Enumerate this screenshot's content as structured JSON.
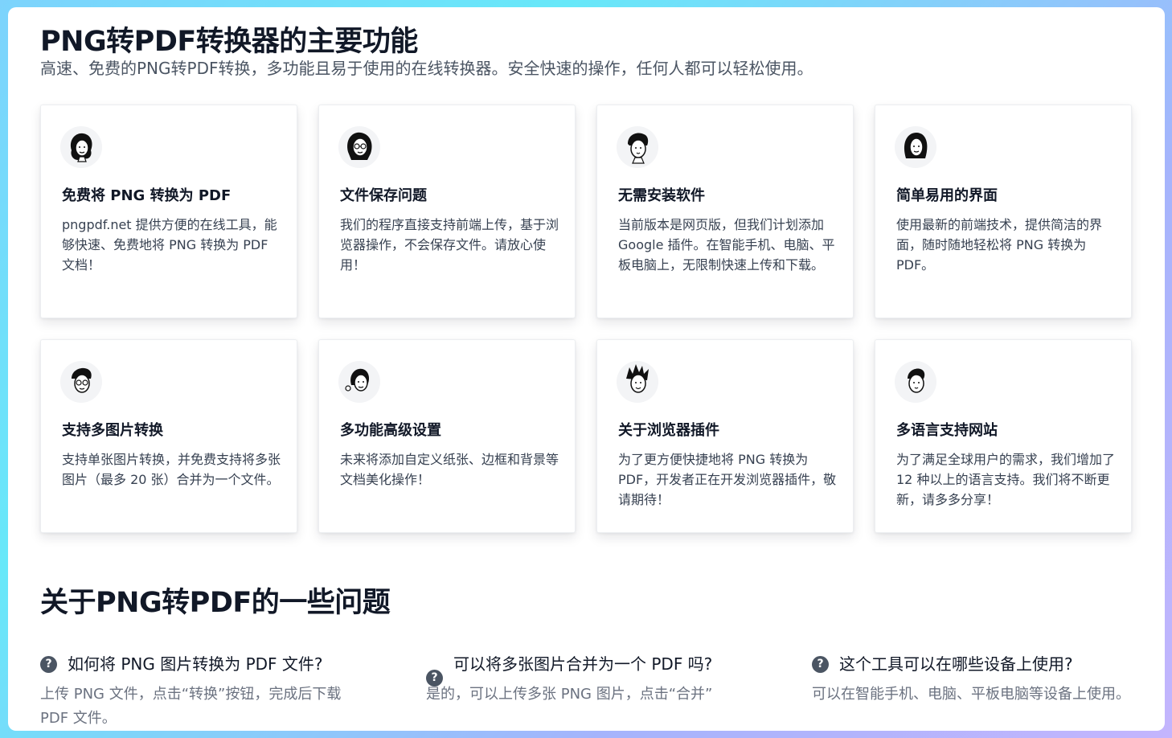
{
  "features": {
    "title": "PNG转PDF转换器的主要功能",
    "subtitle": "高速、免费的PNG转PDF转换，多功能且易于使用的在线转换器。安全快速的操作，任何人都可以轻松使用。",
    "cards": [
      {
        "icon": "woman-avatar-icon",
        "title": "免费将 PNG 转换为 PDF",
        "desc": "pngpdf.net 提供方便的在线工具，能够快速、免费地将 PNG 转换为 PDF 文档！"
      },
      {
        "icon": "woman-glasses-avatar-icon",
        "title": "文件保存问题",
        "desc": "我们的程序直接支持前端上传，基于浏览器操作，不会保存文件。请放心使用！"
      },
      {
        "icon": "man-avatar-icon",
        "title": "无需安装软件",
        "desc": "当前版本是网页版，但我们计划添加 Google 插件。在智能手机、电脑、平板电脑上，无限制快速上传和下载。"
      },
      {
        "icon": "woman-long-hair-avatar-icon",
        "title": "简单易用的界面",
        "desc": "使用最新的前端技术，提供简洁的界面，随时随地轻松将 PNG 转换为 PDF。"
      },
      {
        "icon": "man-glasses-avatar-icon",
        "title": "支持多图片转换",
        "desc": "支持单张图片转换，并免费支持将多张图片（最多 20 张）合并为一个文件。"
      },
      {
        "icon": "woman-flower-avatar-icon",
        "title": "多功能高级设置",
        "desc": "未来将添加自定义纸张、边框和背景等文档美化操作！"
      },
      {
        "icon": "man-spiky-hair-avatar-icon",
        "title": "关于浏览器插件",
        "desc": "为了更方便快捷地将 PNG 转换为 PDF，开发者正在开发浏览器插件，敬请期待！"
      },
      {
        "icon": "man-short-hair-avatar-icon",
        "title": "多语言支持网站",
        "desc": "为了满足全球用户的需求，我们增加了 12 种以上的语言支持。我们将不断更新，请多多分享！"
      }
    ]
  },
  "faq": {
    "title": "关于PNG转PDF的一些问题",
    "icon": "question-circle-icon",
    "items": [
      {
        "q": "如何将 PNG 图片转换为 PDF 文件?",
        "a": "上传 PNG 文件，点击“转换”按钮，完成后下载 PDF 文件。"
      },
      {
        "q": "可以将多张图片合并为一个 PDF 吗?",
        "a": "是的，可以上传多张 PNG 图片，点击“合并”"
      },
      {
        "q": "这个工具可以在哪些设备上使用?",
        "a": "可以在智能手机、电脑、平板电脑等设备上使用。"
      }
    ]
  }
}
